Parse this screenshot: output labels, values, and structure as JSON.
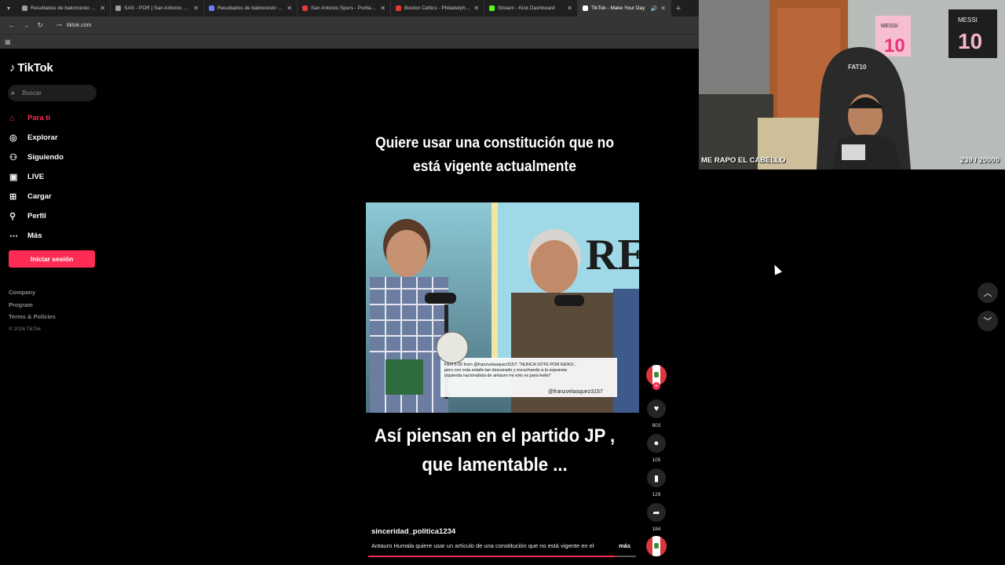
{
  "browser": {
    "tabs": [
      {
        "title": "Resultados de baloncesto en vi",
        "color": "#9e9e9e",
        "active": false
      },
      {
        "title": "SAS - POR | San Antonio Spurs",
        "color": "#9e9e9e",
        "active": false
      },
      {
        "title": "Resultados de baloncesto en di",
        "color": "#6d7cff",
        "active": false
      },
      {
        "title": "San Antonio Spurs - Portland T",
        "color": "#e53935",
        "active": false
      },
      {
        "title": "Boston Celtics - Philadelphia 76",
        "color": "#e53935",
        "active": false
      },
      {
        "title": "Stream - Kick Dashboard",
        "color": "#53fc18",
        "active": false
      },
      {
        "title": "TikTok - Make Your Day",
        "color": "#ffffff",
        "active": true
      }
    ],
    "url": "tiktok.com"
  },
  "sidebar": {
    "logo": "TikTok",
    "search_placeholder": "Buscar",
    "nav": [
      {
        "label": "Para ti",
        "icon": "home-icon",
        "active": true
      },
      {
        "label": "Explorar",
        "icon": "compass-icon",
        "active": false
      },
      {
        "label": "Siguiendo",
        "icon": "following-icon",
        "active": false
      },
      {
        "label": "LIVE",
        "icon": "live-icon",
        "active": false
      },
      {
        "label": "Cargar",
        "icon": "upload-icon",
        "active": false
      },
      {
        "label": "Perfil",
        "icon": "profile-icon",
        "active": false
      },
      {
        "label": "Más",
        "icon": "more-icon",
        "active": false
      }
    ],
    "login_label": "Iniciar sesión",
    "footer": {
      "company": "Company",
      "program": "Program",
      "terms": "Terms & Policies",
      "copyright": "© 2026 TikTok"
    }
  },
  "video": {
    "caption_top": "Quiere usar una constitución que no está vigente actualmente",
    "caption_bottom": "Así piensan en el partido JP , que lamentable ...",
    "overlay_text": "FEN 5.00 from @franzvelasquez3157: \"NUNCA VOTE POR KEIKO , pero con esta estafa tan descarado y escuchando a la supuesta izquierda nacionalista de antauro mi voto es para keiko\"",
    "overlay_handle": "@franzvelasquez3157",
    "author": "sinceridad_politica1234",
    "description": "Antauro Humala quiere usar un artículo de una constitución que no está vigente en el",
    "more_label": "más",
    "progress": 0.92
  },
  "actions": {
    "likes": "803",
    "comments": "105",
    "saves": "129",
    "shares": "184"
  },
  "webcam": {
    "label": "ME RAPO EL CABELLO",
    "counter": "239 / 20000",
    "poster1": "MESSI",
    "poster1_num": "10",
    "poster2": "MESSI",
    "poster2_num": "10",
    "chair": "FAT10"
  },
  "colors": {
    "accent": "#fe2c55",
    "background": "#000000"
  }
}
